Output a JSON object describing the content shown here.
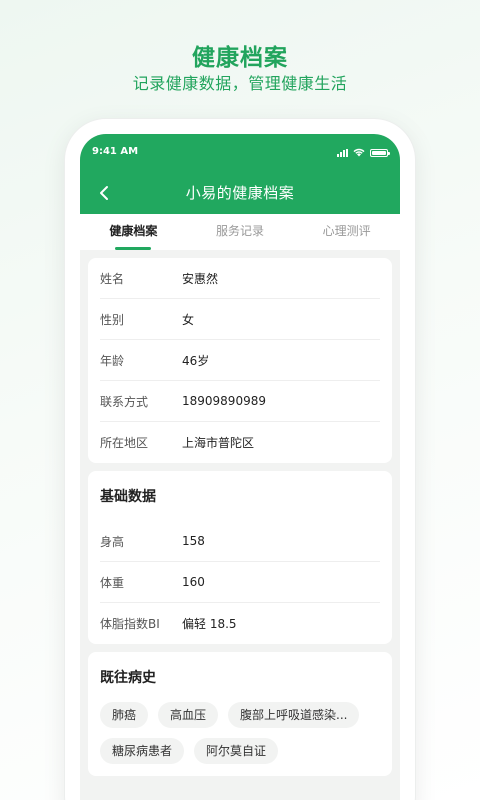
{
  "promo": {
    "title": "健康档案",
    "subtitle": "记录健康数据，管理健康生活"
  },
  "status_bar": {
    "time": "9:41 AM"
  },
  "header": {
    "title": "小易的健康档案"
  },
  "tabs": [
    {
      "label": "健康档案",
      "active": true
    },
    {
      "label": "服务记录",
      "active": false
    },
    {
      "label": "心理测评",
      "active": false
    }
  ],
  "profile": {
    "rows": [
      {
        "label": "姓名",
        "value": "安惠然"
      },
      {
        "label": "性别",
        "value": "女"
      },
      {
        "label": "年龄",
        "value": "46岁"
      },
      {
        "label": "联系方式",
        "value": "18909890989"
      },
      {
        "label": "所在地区",
        "value": "上海市普陀区"
      }
    ]
  },
  "basic_data": {
    "title": "基础数据",
    "rows": [
      {
        "label": "身高",
        "value": "158"
      },
      {
        "label": "体重",
        "value": "160"
      },
      {
        "label": "体脂指数BI",
        "value": "偏轻 18.5"
      }
    ]
  },
  "history": {
    "title": "既往病史",
    "tags": [
      "肺癌",
      "高血压",
      "腹部上呼吸道感染...",
      "糖尿病患者",
      "阿尔莫自证"
    ]
  },
  "colors": {
    "brand": "#21a85f",
    "promo_text": "#22a45d"
  }
}
